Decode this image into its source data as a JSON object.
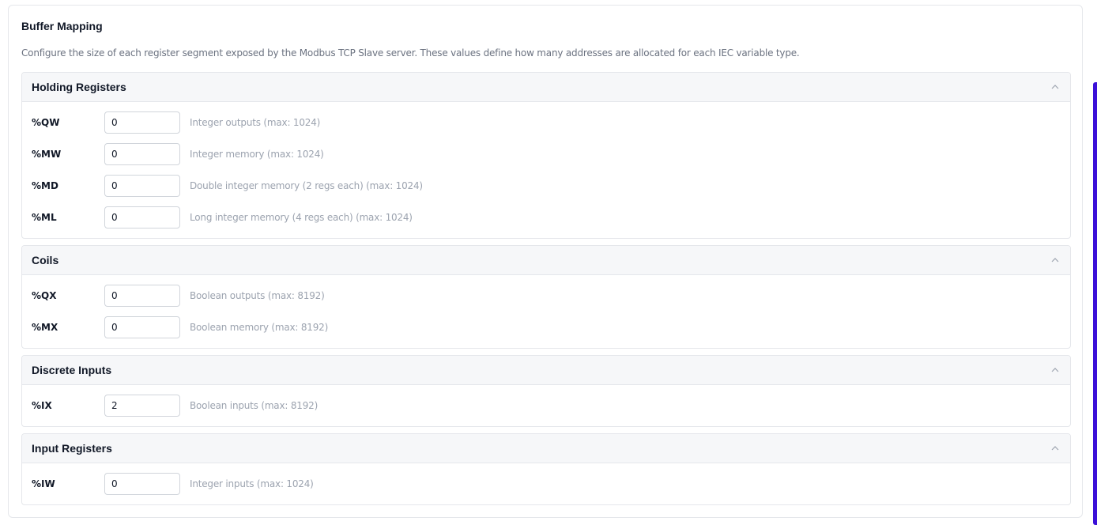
{
  "card": {
    "title": "Buffer Mapping",
    "description": "Configure the size of each register segment exposed by the Modbus TCP Slave server. These values define how many addresses are allocated for each IEC variable type."
  },
  "sections": {
    "holding": {
      "title": "Holding Registers",
      "rows": [
        {
          "label": "%QW",
          "value": "0",
          "hint": "Integer outputs (max: 1024)"
        },
        {
          "label": "%MW",
          "value": "0",
          "hint": "Integer memory (max: 1024)"
        },
        {
          "label": "%MD",
          "value": "0",
          "hint": "Double integer memory (2 regs each) (max: 1024)"
        },
        {
          "label": "%ML",
          "value": "0",
          "hint": "Long integer memory (4 regs each) (max: 1024)"
        }
      ]
    },
    "coils": {
      "title": "Coils",
      "rows": [
        {
          "label": "%QX",
          "value": "0",
          "hint": "Boolean outputs (max: 8192)"
        },
        {
          "label": "%MX",
          "value": "0",
          "hint": "Boolean memory (max: 8192)"
        }
      ]
    },
    "discrete": {
      "title": "Discrete Inputs",
      "rows": [
        {
          "label": "%IX",
          "value": "2",
          "hint": "Boolean inputs (max: 8192)"
        }
      ]
    },
    "input": {
      "title": "Input Registers",
      "rows": [
        {
          "label": "%IW",
          "value": "0",
          "hint": "Integer inputs (max: 1024)"
        }
      ]
    }
  },
  "icons": {
    "collapse": "chevron-up-icon"
  },
  "colors": {
    "scrollbar": "#3b10d8",
    "header_bg": "#f6f7f9",
    "hint_text": "#9ca3af"
  }
}
